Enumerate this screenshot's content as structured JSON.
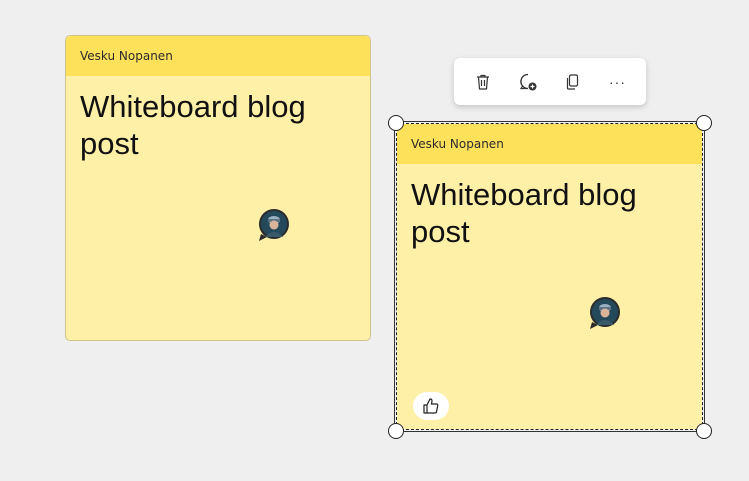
{
  "notes": [
    {
      "author": "Vesku Nopanen",
      "text": "Whiteboard blog post"
    },
    {
      "author": "Vesku Nopanen",
      "text": "Whiteboard blog post"
    }
  ],
  "toolbar": {
    "buttons": [
      {
        "icon": "trash-icon",
        "label": "Delete"
      },
      {
        "icon": "add-comment-icon",
        "label": "Add comment"
      },
      {
        "icon": "copy-icon",
        "label": "Copy"
      },
      {
        "icon": "more-icon",
        "label": "···"
      }
    ]
  },
  "colors": {
    "note_body": "#fff0a8",
    "note_header": "#fde15a",
    "canvas": "#efefef"
  }
}
